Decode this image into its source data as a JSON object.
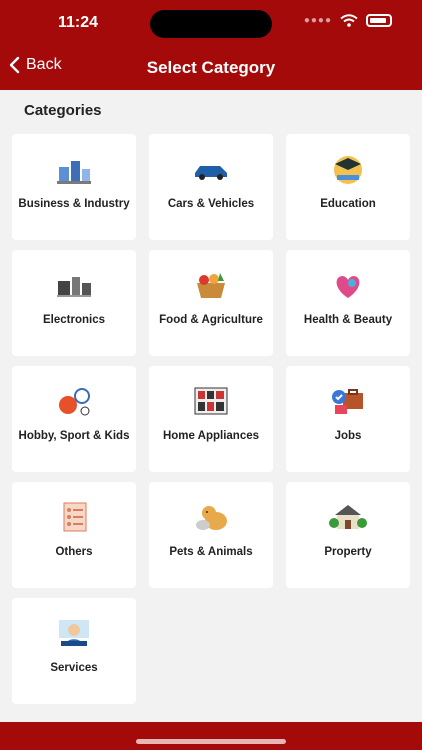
{
  "status": {
    "time": "11:24"
  },
  "header": {
    "back_label": "Back",
    "title": "Select Category"
  },
  "section_title": "Categories",
  "categories": [
    {
      "label": "Business & Industry",
      "icon": "business-icon"
    },
    {
      "label": "Cars & Vehicles",
      "icon": "car-icon"
    },
    {
      "label": "Education",
      "icon": "education-icon"
    },
    {
      "label": "Electronics",
      "icon": "electronics-icon"
    },
    {
      "label": "Food & Agriculture",
      "icon": "food-icon"
    },
    {
      "label": "Health & Beauty",
      "icon": "health-icon"
    },
    {
      "label": "Hobby, Sport & Kids",
      "icon": "hobby-icon"
    },
    {
      "label": "Home Appliances",
      "icon": "appliances-icon"
    },
    {
      "label": "Jobs",
      "icon": "jobs-icon"
    },
    {
      "label": "Others",
      "icon": "others-icon"
    },
    {
      "label": "Pets & Animals",
      "icon": "pets-icon"
    },
    {
      "label": "Property",
      "icon": "property-icon"
    },
    {
      "label": "Services",
      "icon": "services-icon"
    }
  ],
  "colors": {
    "primary": "#a50a0a",
    "background": "#f2f2f2"
  }
}
